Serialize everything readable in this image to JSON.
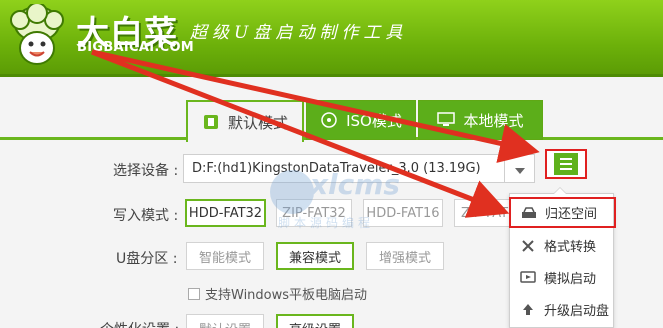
{
  "header": {
    "brand": "大白菜",
    "domain": "BIGBAICAI.COM",
    "slogan": "超级U盘启动制作工具"
  },
  "mode_tabs": [
    {
      "label": "默认模式",
      "icon": "usb-icon",
      "active": true
    },
    {
      "label": "ISO模式",
      "icon": "disc-icon",
      "active": false
    },
    {
      "label": "本地模式",
      "icon": "monitor-icon",
      "active": false
    }
  ],
  "device": {
    "label": "选择设备 :",
    "value": "D:F:(hd1)KingstonDataTraveler_3.0 (13.19G)"
  },
  "write_mode": {
    "label": "写入模式 :",
    "options": [
      "HDD-FAT32",
      "ZIP-FAT32",
      "HDD-FAT16",
      "ZIP-FAT"
    ],
    "selected": "HDD-FAT32"
  },
  "partition": {
    "label": "U盘分区 :",
    "options": [
      "智能模式",
      "兼容模式",
      "增强模式"
    ],
    "selected": "兼容模式",
    "checkbox_label": "支持Windows平板电脑启动"
  },
  "personalize": {
    "label": "个性化设置 :",
    "options": [
      "默认设置",
      "高级设置"
    ]
  },
  "dropdown_menu": [
    {
      "label": "归还空间",
      "icon": "restore-icon",
      "highlighted": true
    },
    {
      "label": "格式转换",
      "icon": "convert-icon",
      "highlighted": false
    },
    {
      "label": "模拟启动",
      "icon": "simulate-icon",
      "highlighted": false
    },
    {
      "label": "升级启动盘",
      "icon": "upgrade-icon",
      "highlighted": false
    }
  ],
  "watermark": {
    "line1": "xlcms",
    "line2": "脚本源码编程"
  },
  "colors": {
    "brand_green": "#6cb00a",
    "highlight_red": "#e02020",
    "arrow_red": "#e03020"
  }
}
